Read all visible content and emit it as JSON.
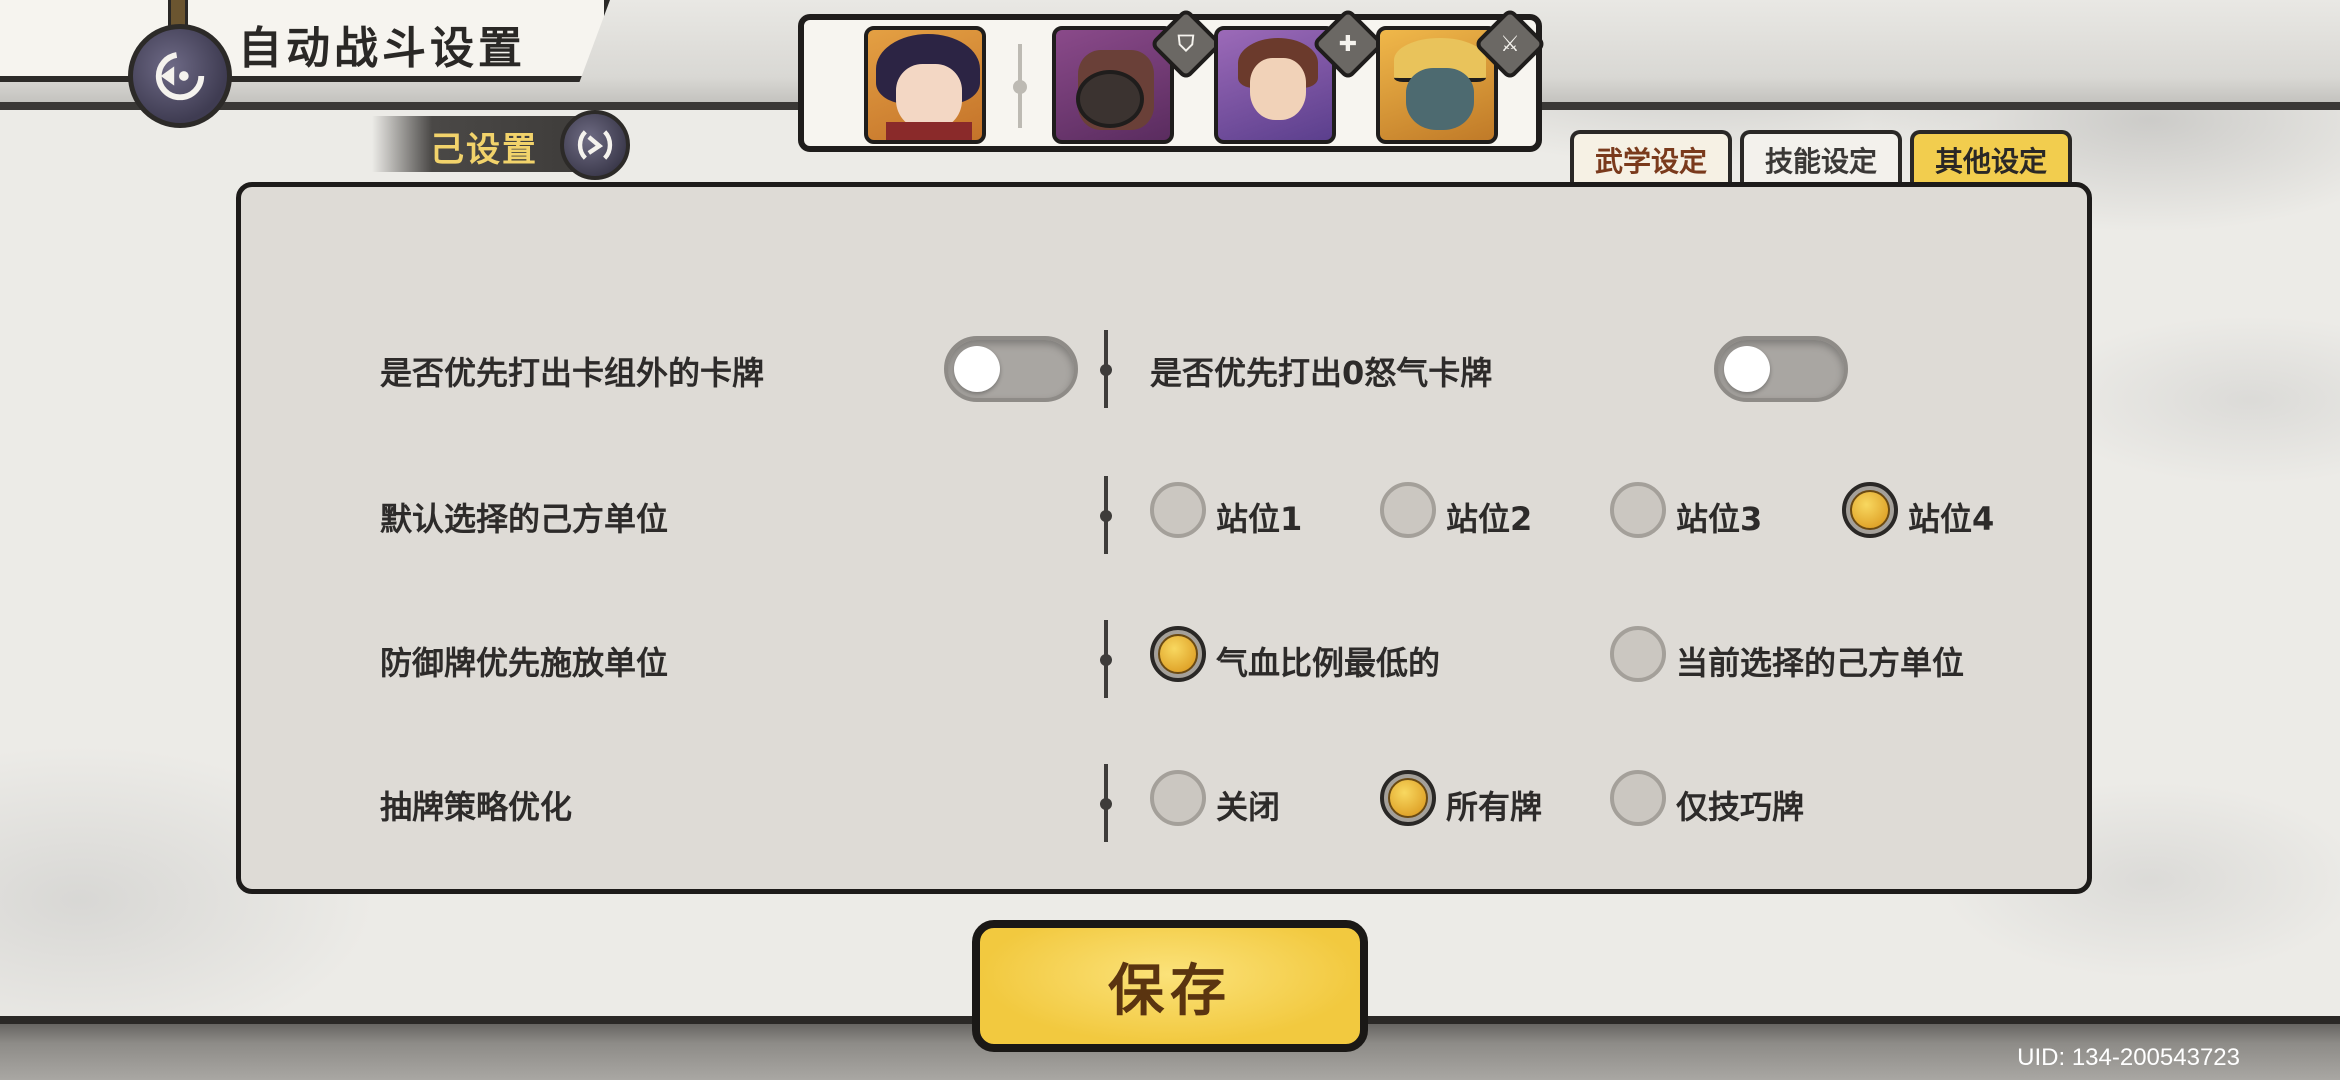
{
  "header": {
    "title": "自动战斗设置",
    "preset_label": "己设置"
  },
  "characters": [
    {
      "name": "character-1",
      "role_icon": ""
    },
    {
      "name": "character-2",
      "role_icon": "shield-icon"
    },
    {
      "name": "character-3",
      "role_icon": "heal-icon"
    },
    {
      "name": "character-4",
      "role_icon": "sword-icon"
    }
  ],
  "tabs": [
    {
      "label": "武学设定",
      "active": false
    },
    {
      "label": "技能设定",
      "active": false
    },
    {
      "label": "其他设定",
      "active": true
    }
  ],
  "settings": {
    "row1": {
      "left_label": "是否优先打出卡组外的卡牌",
      "left_toggle_on": false,
      "right_label": "是否优先打出0怒气卡牌",
      "right_toggle_on": false
    },
    "row2": {
      "label": "默认选择的己方单位",
      "options": [
        "站位1",
        "站位2",
        "站位3",
        "站位4"
      ],
      "selected": "站位4"
    },
    "row3": {
      "label": "防御牌优先施放单位",
      "options": [
        "气血比例最低的",
        "当前选择的己方单位"
      ],
      "selected": "气血比例最低的"
    },
    "row4": {
      "label": "抽牌策略优化",
      "options": [
        "关闭",
        "所有牌",
        "仅技巧牌"
      ],
      "selected": "所有牌"
    }
  },
  "save_label": "保存",
  "uid": "UID:  134-200543723",
  "colors": {
    "accent": "#f2cd4e",
    "selected_radio": "#e9b436",
    "panel": "#dedbd6"
  }
}
